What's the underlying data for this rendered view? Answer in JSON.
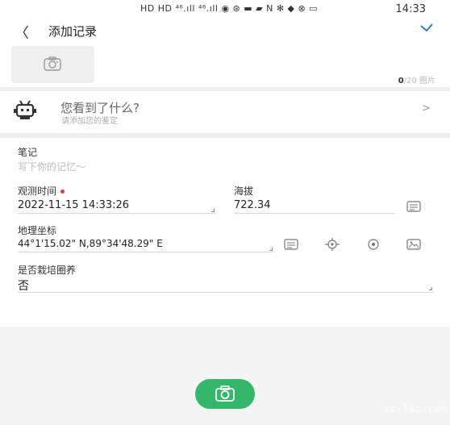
{
  "statusbar": {
    "icons": "HD HD ⁴⁶.ıll ⁴⁶.ıll ◉ ⊛ ▬ ▰  N ✻ ◆ ⊗ ▭ ",
    "time": "14:33"
  },
  "header": {
    "back_icon": "chevron-left-icon",
    "title": "添加记录",
    "confirm_icon": "check-icon"
  },
  "photo": {
    "count_current": "0",
    "count_suffix": "/20 图片"
  },
  "found": {
    "title": "您看到了什么?",
    "subtitle": "请添加您的鉴定",
    "chevron": ">"
  },
  "form": {
    "notes_label": "笔记",
    "notes_placeholder": "写下你的记忆～",
    "time_label": "观测时间",
    "time_value": "2022-11-15 14:33:26",
    "altitude_label": "海拔",
    "altitude_value": "722.34",
    "coords_label": "地理坐标",
    "coords_value": "44°1'15.02\" N,89°34'48.29\" E",
    "captive_label": "是否栽培圈养",
    "captive_value": "否"
  },
  "watermark": "sc-lac.com",
  "colors": {
    "accent_green": "#33b86b",
    "check_blue": "#2a7fd8",
    "required_red": "#e53935"
  }
}
